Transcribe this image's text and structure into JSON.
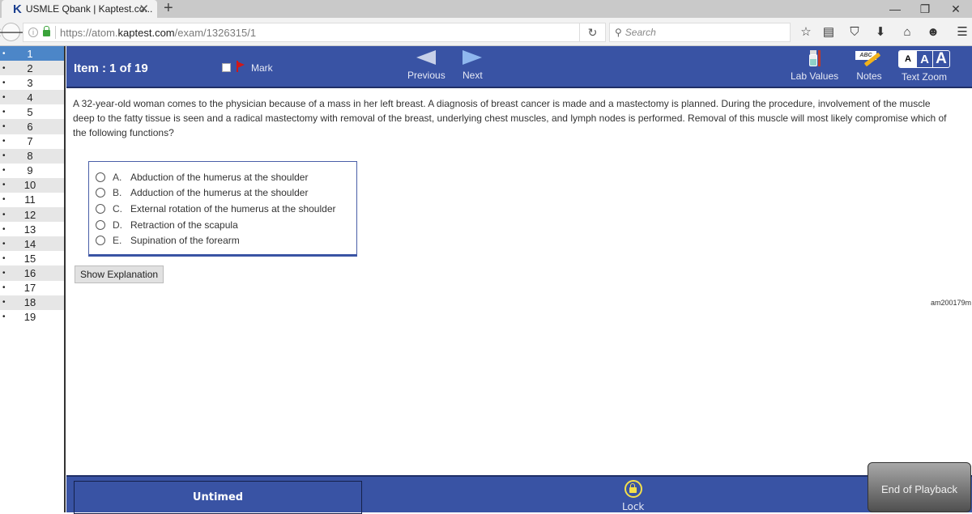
{
  "browser": {
    "tab_title": "USMLE Qbank | Kaptest.co...",
    "tab_logo": "K",
    "url_prefix": "https://atom.",
    "url_domain": "kaptest.com",
    "url_path": "/exam/1326315/1",
    "search_placeholder": "Search",
    "toolbar_icons": [
      "star-icon",
      "reading-list-icon",
      "pocket-icon",
      "download-icon",
      "home-icon",
      "smiley-icon",
      "menu-icon"
    ]
  },
  "sidebar": {
    "items": [
      {
        "num": "1",
        "active": true
      },
      {
        "num": "2"
      },
      {
        "num": "3"
      },
      {
        "num": "4"
      },
      {
        "num": "5"
      },
      {
        "num": "6"
      },
      {
        "num": "7"
      },
      {
        "num": "8"
      },
      {
        "num": "9"
      },
      {
        "num": "10"
      },
      {
        "num": "11"
      },
      {
        "num": "12"
      },
      {
        "num": "13"
      },
      {
        "num": "14"
      },
      {
        "num": "15"
      },
      {
        "num": "16"
      },
      {
        "num": "17"
      },
      {
        "num": "18"
      },
      {
        "num": "19"
      }
    ]
  },
  "header": {
    "item_label": "Item : 1 of 19",
    "mark_label": "Mark",
    "previous_label": "Previous",
    "next_label": "Next",
    "lab_values_label": "Lab Values",
    "notes_label": "Notes",
    "notes_icon_text": "ABC",
    "text_zoom_label": "Text Zoom",
    "zoom_options": [
      "A",
      "A",
      "A"
    ]
  },
  "question": {
    "stem": "A 32-year-old woman comes to the physician because of a mass in her left breast. A diagnosis of breast cancer is made and a mastectomy is planned. During the procedure, involvement of the muscle deep to the fatty tissue is seen and a radical mastectomy with removal of the breast, underlying chest muscles, and lymph nodes is performed. Removal of this muscle will most likely compromise which of the following functions?",
    "choices": [
      {
        "letter": "A.",
        "text": "Abduction of the humerus at the shoulder"
      },
      {
        "letter": "B.",
        "text": "Adduction of the humerus at the shoulder"
      },
      {
        "letter": "C.",
        "text": "External rotation of the humerus at the shoulder"
      },
      {
        "letter": "D.",
        "text": "Retraction of the scapula"
      },
      {
        "letter": "E.",
        "text": "Supination of the forearm"
      }
    ],
    "show_explanation_label": "Show Explanation",
    "question_id": "am200179m"
  },
  "footer": {
    "timer_label": "Untimed",
    "lock_label": "Lock",
    "end_playback_label": "End of Playback"
  },
  "colors": {
    "brand_blue": "#3953a4",
    "active_item": "#4c86c8",
    "mark_flag": "#d01818",
    "lock_yellow": "#f4e04a"
  }
}
